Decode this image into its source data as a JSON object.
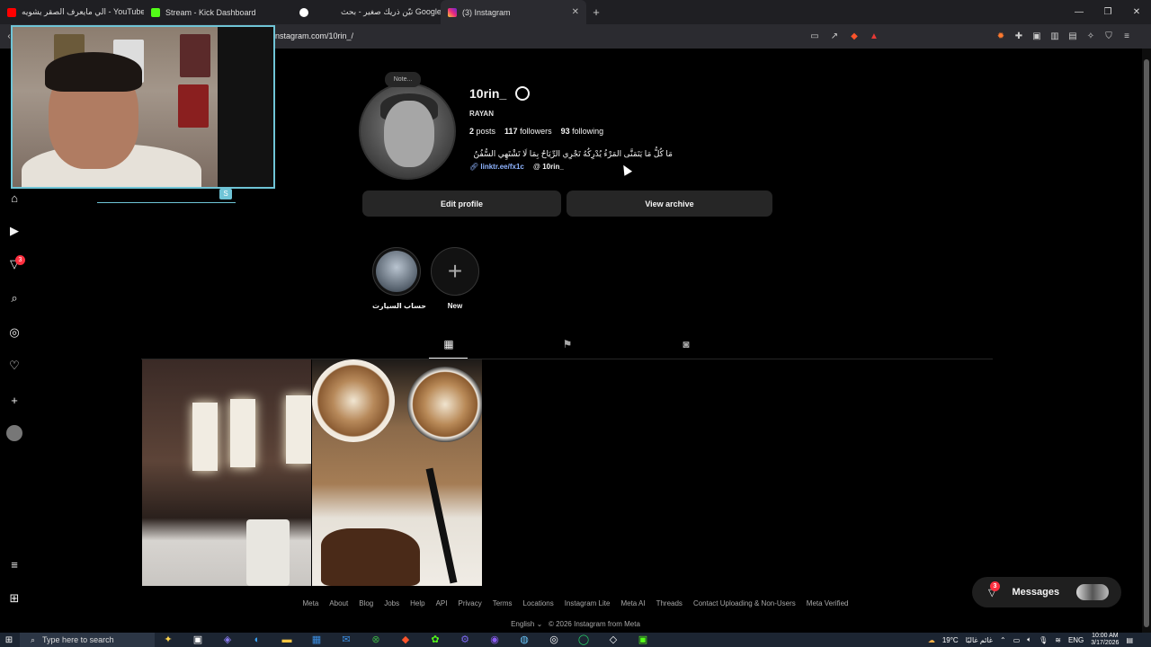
{
  "browser": {
    "tabs": [
      {
        "title": "الي مايعرف الصقر يشويه - YouTube",
        "active": false
      },
      {
        "title": "Stream - Kick Dashboard",
        "active": false
      },
      {
        "title": "تيّن ذريك صغير - بحث Google",
        "active": false
      },
      {
        "title": "(3) Instagram",
        "active": true
      }
    ],
    "url": "instagram.com/10rin_/",
    "window_controls": [
      "—",
      "❐",
      "✕"
    ]
  },
  "profile": {
    "note": "Note...",
    "username": "10rin_",
    "display_name": "RAYAN",
    "posts_count": "2",
    "posts_label": "posts",
    "followers_count": "117",
    "followers_label": "followers",
    "following_count": "93",
    "following_label": "following",
    "bio": "مَا كُلُّ مَا يَتَمَنَّى المَرْءُ يُدْرِكُهُ تَجْرِي الرِّيَاحُ بِمَا لَا تَشْتَهِي السُّفُنُ",
    "link": "linktr.ee/fx1c",
    "threads_handle": "10rin_",
    "edit_profile_label": "Edit profile",
    "view_archive_label": "View archive"
  },
  "highlights": [
    {
      "label": "حساب السيارت"
    },
    {
      "label": "New"
    }
  ],
  "notifications": {
    "activity_badge": "3",
    "messages_badge": "3",
    "messages_label": "Messages"
  },
  "footer": {
    "links": [
      "Meta",
      "About",
      "Blog",
      "Jobs",
      "Help",
      "API",
      "Privacy",
      "Terms",
      "Locations",
      "Instagram Lite",
      "Meta AI",
      "Threads",
      "Contact Uploading & Non-Users",
      "Meta Verified"
    ],
    "language": "English",
    "copyright": "© 2026 Instagram from Meta"
  },
  "taskbar": {
    "search_placeholder": "Type here to search",
    "weather": "19°C",
    "weather_text": "غائم غالبًا",
    "language": "ENG",
    "time": "10:00 AM",
    "date": "3/17/2026"
  },
  "webcam": {
    "overlay_letter": "S"
  },
  "colors": {
    "accent_link": "#8fb4ff",
    "badge": "#ff3040",
    "webcam_border": "#6fc4d6"
  }
}
